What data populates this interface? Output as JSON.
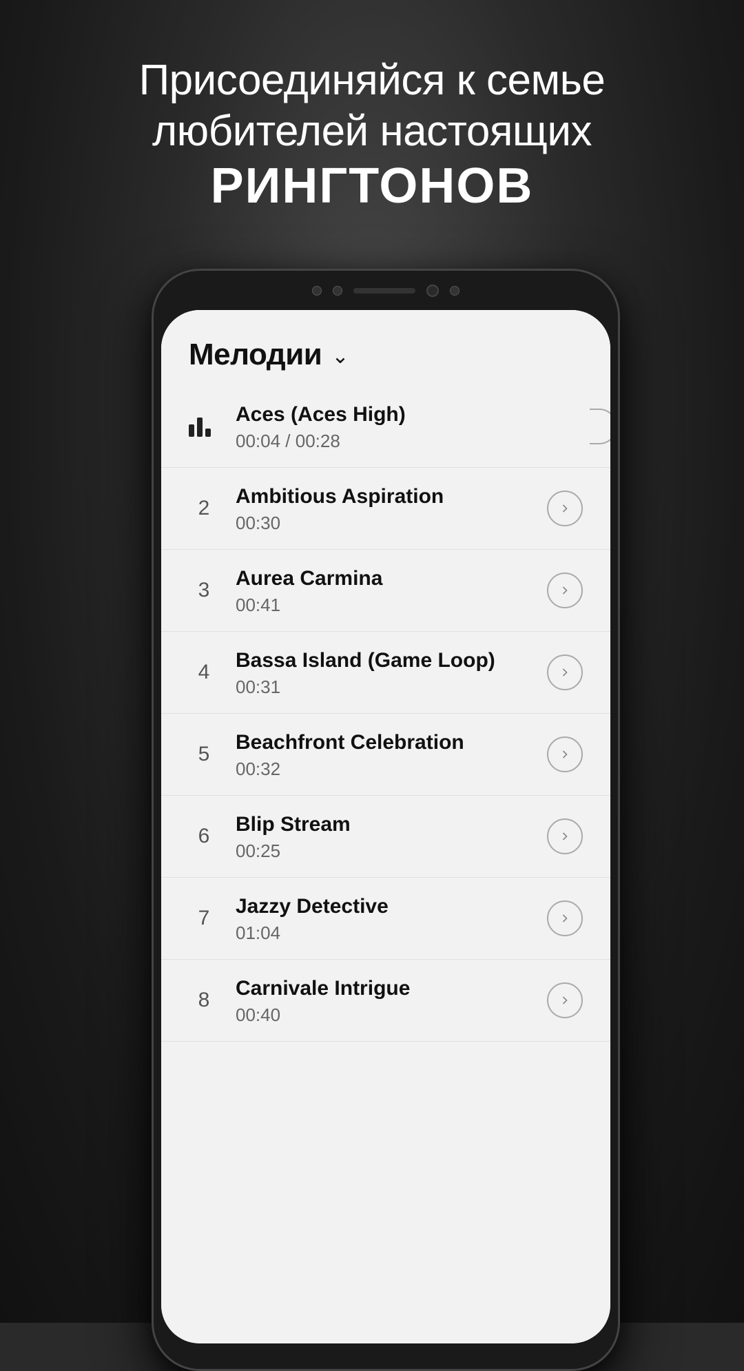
{
  "promo": {
    "line1": "Присоединяйся к семье любителей настоящих",
    "bold": "РИНГТОНОВ"
  },
  "app": {
    "header": {
      "title": "Мелодии",
      "chevron": "∨"
    },
    "tracks": [
      {
        "id": 1,
        "number": "",
        "name": "Aces (Aces High)",
        "duration": "00:04 / 00:28",
        "playing": true,
        "showAction": true
      },
      {
        "id": 2,
        "number": "2",
        "name": "Ambitious Aspiration",
        "duration": "00:30",
        "playing": false,
        "showAction": true
      },
      {
        "id": 3,
        "number": "3",
        "name": "Aurea Carmina",
        "duration": "00:41",
        "playing": false,
        "showAction": true
      },
      {
        "id": 4,
        "number": "4",
        "name": "Bassa Island (Game Loop)",
        "duration": "00:31",
        "playing": false,
        "showAction": true
      },
      {
        "id": 5,
        "number": "5",
        "name": "Beachfront Celebration",
        "duration": "00:32",
        "playing": false,
        "showAction": true
      },
      {
        "id": 6,
        "number": "6",
        "name": "Blip Stream",
        "duration": "00:25",
        "playing": false,
        "showAction": true
      },
      {
        "id": 7,
        "number": "7",
        "name": "Jazzy Detective",
        "duration": "01:04",
        "playing": false,
        "showAction": true
      },
      {
        "id": 8,
        "number": "8",
        "name": "Carnivale Intrigue",
        "duration": "00:40",
        "playing": false,
        "showAction": true
      }
    ]
  }
}
